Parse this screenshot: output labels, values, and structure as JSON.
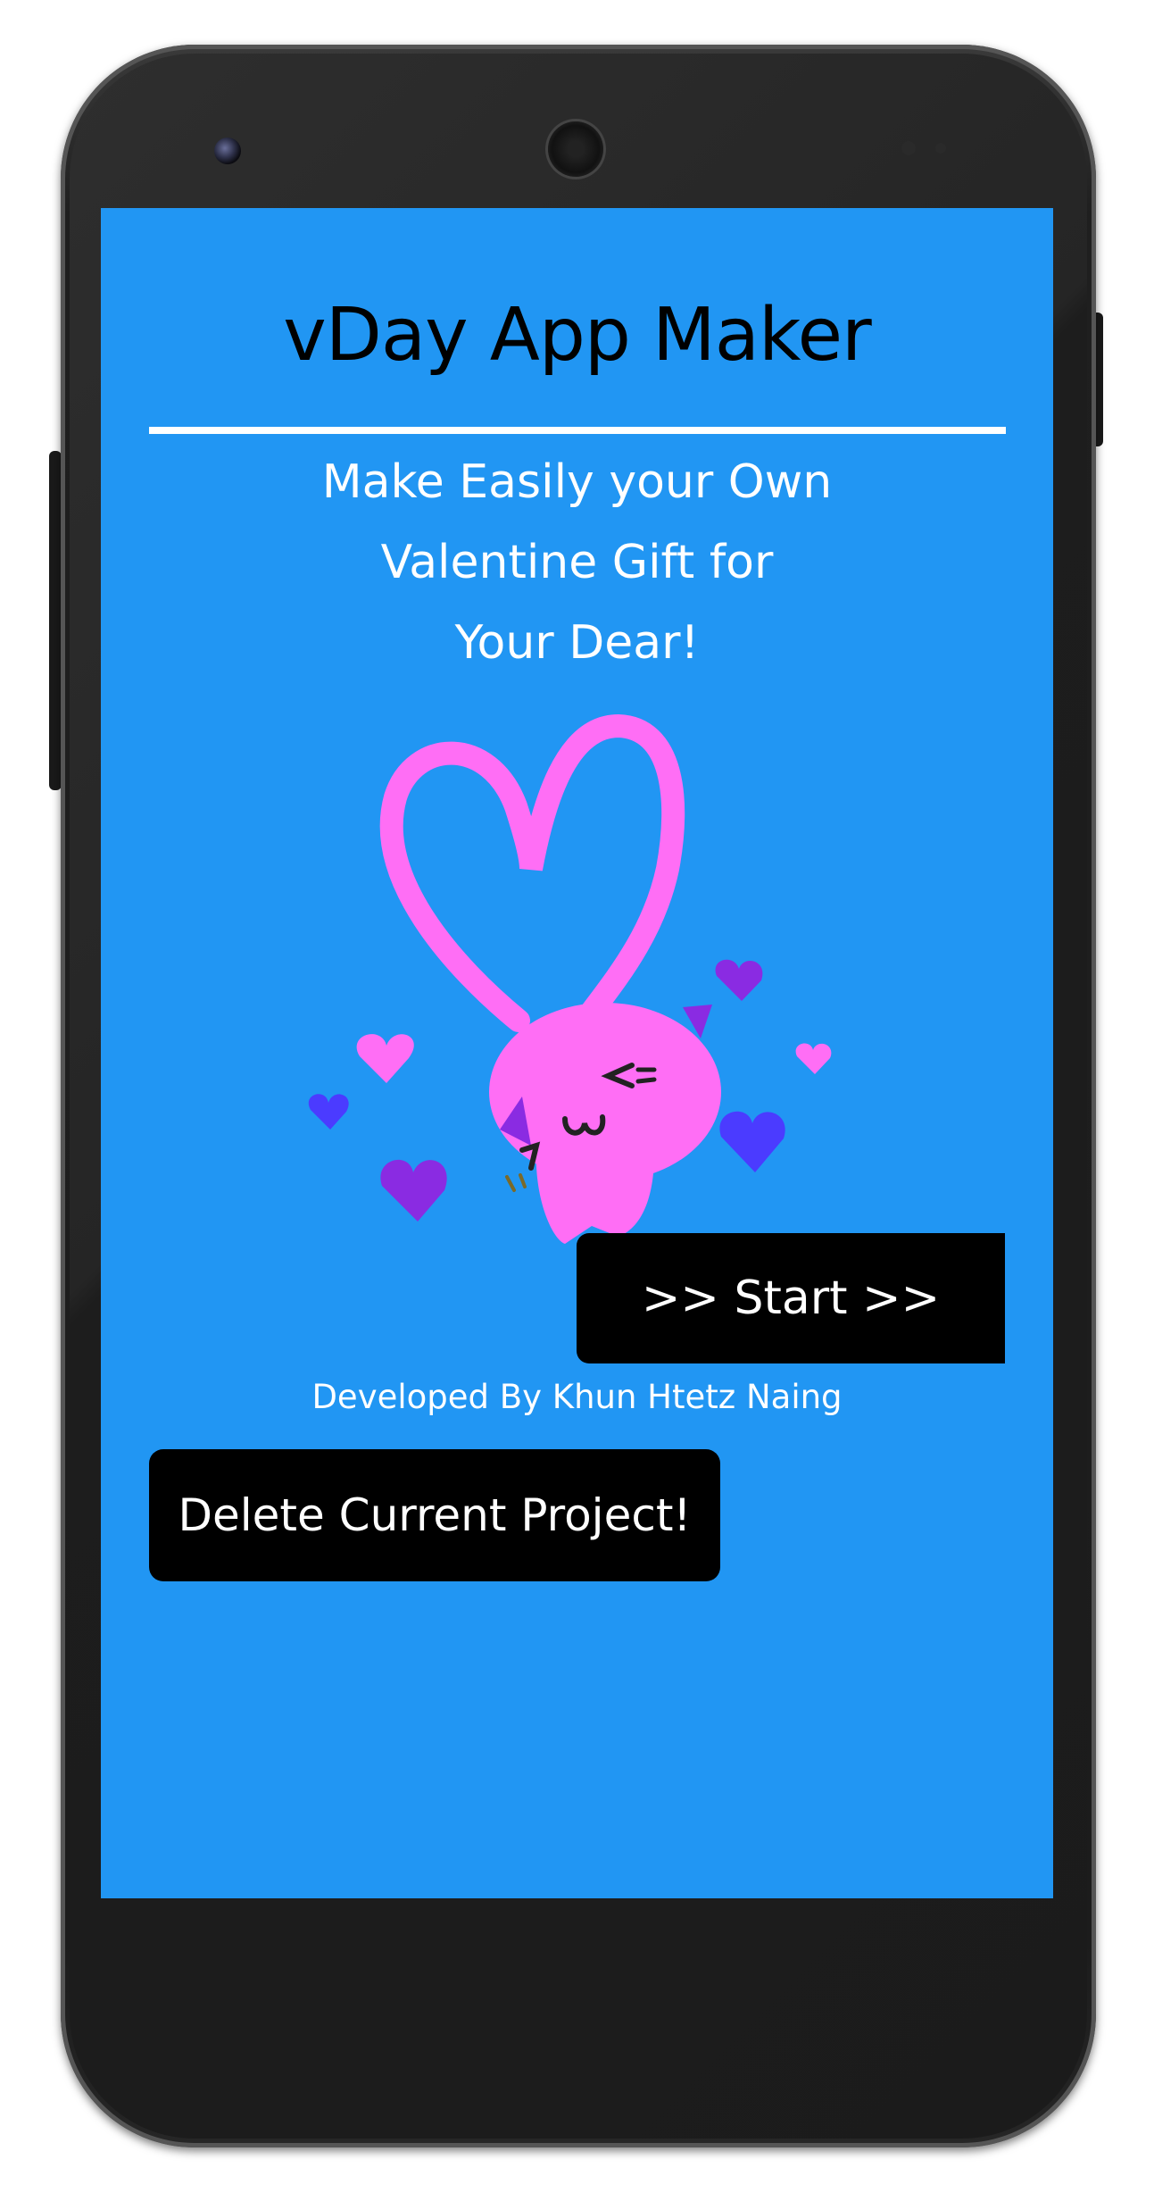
{
  "app": {
    "title": "vDay App Maker",
    "tagline": [
      "Make Easily your Own",
      "Valentine Gift for",
      "Your Dear!"
    ],
    "start_label": ">> Start >>",
    "credit": "Developed By Khun Htetz Naing",
    "delete_label": "Delete Current Project!"
  },
  "colors": {
    "screen_background": "#2196F3",
    "button_background": "#000000",
    "text_light": "#FFFFFF",
    "title_text": "#000000",
    "heart_pink": "#FF6EF5",
    "heart_purple": "#8A2BE2",
    "heart_blue": "#4B3BFF"
  },
  "icons": {
    "illustration": "cat-with-hearts-illustration"
  }
}
